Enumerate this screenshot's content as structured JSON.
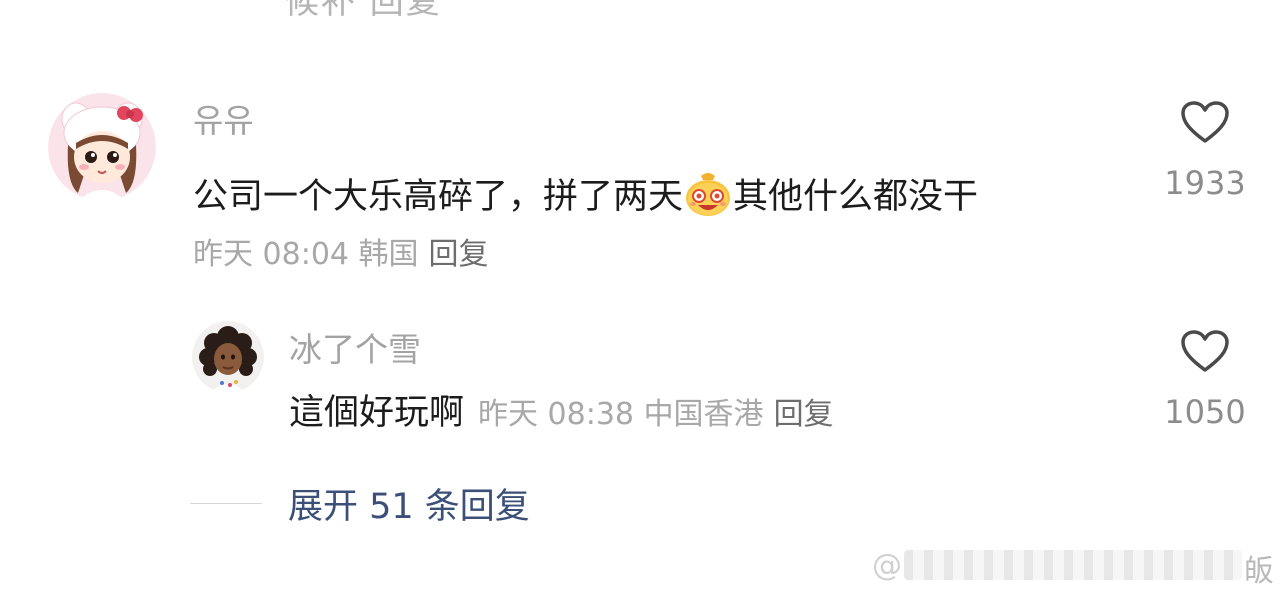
{
  "top_cut_text": "候补 回复",
  "comment": {
    "username": "유유",
    "text_before_emoji": "公司一个大乐高碎了，拼了两天",
    "emoji": "grinning-bag-emoji",
    "text_after_emoji": "其他什么都没干",
    "time": "昨天 08:04",
    "location": "韩国",
    "reply_label": "回复",
    "likes": "1933"
  },
  "reply": {
    "username": "冰了个雪",
    "text": "這個好玩啊",
    "time": "昨天 08:38",
    "location": "中国香港",
    "reply_label": "回复",
    "likes": "1050"
  },
  "expand": {
    "label": "展开 51 条回复"
  },
  "watermark": {
    "logo": "@",
    "tail": "皈"
  },
  "icons": {
    "like": "heart-outline-icon"
  },
  "colors": {
    "username": "#a3a3a3",
    "text": "#1c1c1c",
    "meta": "#a8a8a8",
    "link": "#3b4f78"
  }
}
